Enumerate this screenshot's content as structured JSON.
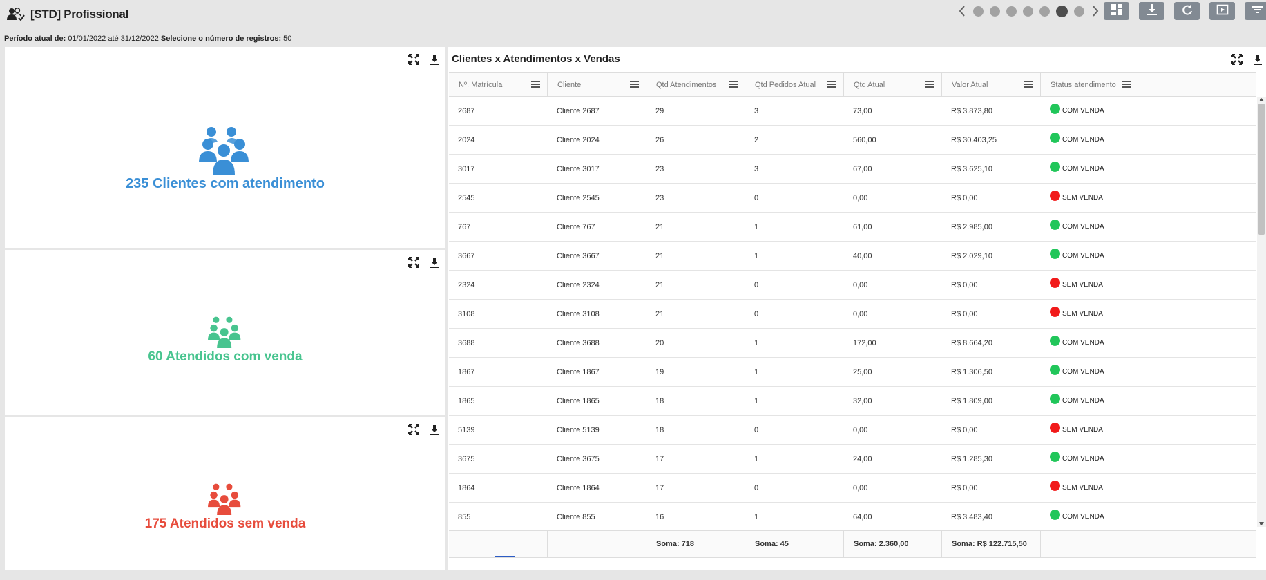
{
  "app": {
    "title": "[STD] Profissional",
    "title_icon": "users-check-icon"
  },
  "pager": {
    "dot_count": 7,
    "active_index": 5
  },
  "toolbar": {
    "buttons": [
      {
        "name": "layout-button",
        "icon": "grid-layout-icon"
      },
      {
        "name": "download-button",
        "icon": "download-icon"
      },
      {
        "name": "refresh-button",
        "icon": "refresh-icon"
      },
      {
        "name": "presentation-button",
        "icon": "play-icon"
      },
      {
        "name": "filter-button",
        "icon": "filter-icon"
      }
    ]
  },
  "period": {
    "label": "Período atual de:",
    "range": "01/01/2022 até 31/12/2022",
    "records_label": "Selecione o número de registros:",
    "records_value": "50"
  },
  "kpis": [
    {
      "text": "235 Clientes com atendimento",
      "color": "#3a8fd6"
    },
    {
      "text": "60 Atendidos com venda",
      "color": "#48c48f"
    },
    {
      "text": "175 Atendidos sem venda",
      "color": "#e74c3c"
    }
  ],
  "table": {
    "title": "Clientes x Atendimentos x Vendas",
    "columns": [
      "Nº. Matrícula",
      "Cliente",
      "Qtd Atendimentos",
      "Qtd Pedidos Atual",
      "Qtd Atual",
      "Valor Atual",
      "Status atendimento"
    ],
    "rows": [
      [
        "2687",
        "Cliente 2687",
        "29",
        "3",
        "73,00",
        "R$ 3.873,80",
        "COM VENDA"
      ],
      [
        "2024",
        "Cliente 2024",
        "26",
        "2",
        "560,00",
        "R$ 30.403,25",
        "COM VENDA"
      ],
      [
        "3017",
        "Cliente 3017",
        "23",
        "3",
        "67,00",
        "R$ 3.625,10",
        "COM VENDA"
      ],
      [
        "2545",
        "Cliente 2545",
        "23",
        "0",
        "0,00",
        "R$ 0,00",
        "SEM VENDA"
      ],
      [
        "767",
        "Cliente 767",
        "21",
        "1",
        "61,00",
        "R$ 2.985,00",
        "COM VENDA"
      ],
      [
        "3667",
        "Cliente 3667",
        "21",
        "1",
        "40,00",
        "R$ 2.029,10",
        "COM VENDA"
      ],
      [
        "2324",
        "Cliente 2324",
        "21",
        "0",
        "0,00",
        "R$ 0,00",
        "SEM VENDA"
      ],
      [
        "3108",
        "Cliente 3108",
        "21",
        "0",
        "0,00",
        "R$ 0,00",
        "SEM VENDA"
      ],
      [
        "3688",
        "Cliente 3688",
        "20",
        "1",
        "172,00",
        "R$ 8.664,20",
        "COM VENDA"
      ],
      [
        "1867",
        "Cliente 1867",
        "19",
        "1",
        "25,00",
        "R$ 1.306,50",
        "COM VENDA"
      ],
      [
        "1865",
        "Cliente 1865",
        "18",
        "1",
        "32,00",
        "R$ 1.809,00",
        "COM VENDA"
      ],
      [
        "5139",
        "Cliente 5139",
        "18",
        "0",
        "0,00",
        "R$ 0,00",
        "SEM VENDA"
      ],
      [
        "3675",
        "Cliente 3675",
        "17",
        "1",
        "24,00",
        "R$ 1.285,30",
        "COM VENDA"
      ],
      [
        "1864",
        "Cliente 1864",
        "17",
        "0",
        "0,00",
        "R$ 0,00",
        "SEM VENDA"
      ],
      [
        "855",
        "Cliente 855",
        "16",
        "1",
        "64,00",
        "R$ 3.483,40",
        "COM VENDA"
      ]
    ],
    "footer": [
      "",
      "",
      "Soma: 718",
      "Soma: 45",
      "Soma: 2.360,00",
      "Soma: R$ 122.715,50",
      ""
    ],
    "status_colors": {
      "COM VENDA": "#21c65a",
      "SEM VENDA": "#f11a1a"
    }
  }
}
